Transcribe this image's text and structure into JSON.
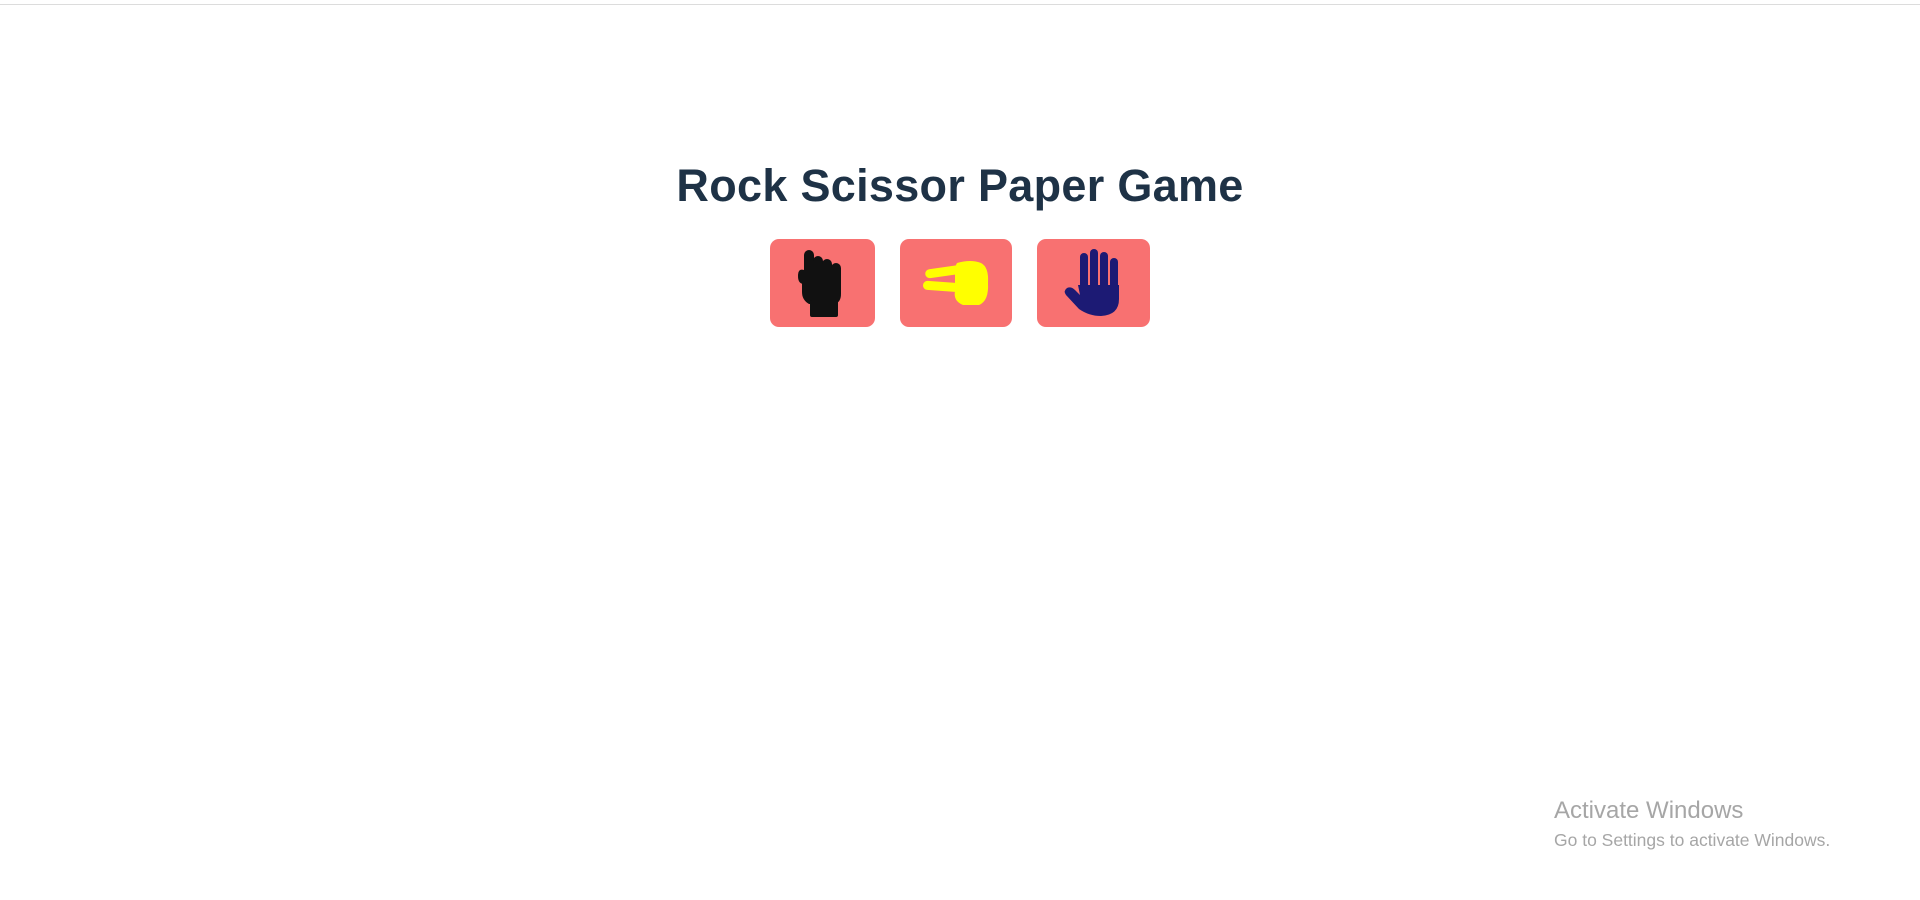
{
  "page": {
    "title": "Rock Scissor Paper Game",
    "title_color": "#1e3246",
    "background": "#ffffff"
  },
  "choices": [
    {
      "name": "rock",
      "icon": "fist-icon",
      "button_color": "#f87171",
      "icon_color": "#111111"
    },
    {
      "name": "scissor",
      "icon": "scissors-hand-icon",
      "button_color": "#f87171",
      "icon_color": "#ffff00"
    },
    {
      "name": "paper",
      "icon": "open-hand-icon",
      "button_color": "#f87171",
      "icon_color": "#1c1a74"
    }
  ],
  "watermark": {
    "title": "Activate Windows",
    "subtitle": "Go to Settings to activate Windows."
  }
}
